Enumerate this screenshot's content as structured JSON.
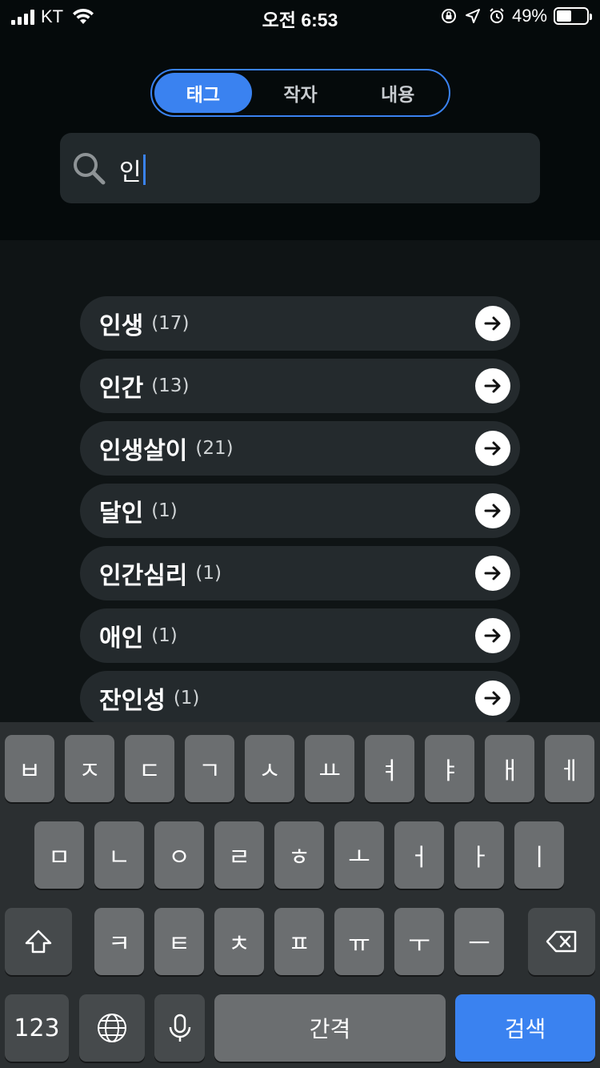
{
  "status_bar": {
    "carrier": "KT",
    "time": "오전 6:53",
    "battery": "49%",
    "battery_level": 0.49
  },
  "tabs": [
    {
      "label": "태그",
      "active": true
    },
    {
      "label": "작자",
      "active": false
    },
    {
      "label": "내용",
      "active": false
    }
  ],
  "search": {
    "value": "인",
    "icon": "search-icon"
  },
  "results": [
    {
      "name": "인생",
      "count": "(17)"
    },
    {
      "name": "인간",
      "count": "(13)"
    },
    {
      "name": "인생살이",
      "count": "(21)"
    },
    {
      "name": "달인",
      "count": "(1)"
    },
    {
      "name": "인간심리",
      "count": "(1)"
    },
    {
      "name": "애인",
      "count": "(1)"
    },
    {
      "name": "잔인성",
      "count": "(1)"
    }
  ],
  "keyboard": {
    "row1": [
      "ㅂ",
      "ㅈ",
      "ㄷ",
      "ㄱ",
      "ㅅ",
      "ㅛ",
      "ㅕ",
      "ㅑ",
      "ㅐ",
      "ㅔ"
    ],
    "row2": [
      "ㅁ",
      "ㄴ",
      "ㅇ",
      "ㄹ",
      "ㅎ",
      "ㅗ",
      "ㅓ",
      "ㅏ",
      "ㅣ"
    ],
    "row3": [
      "ㅋ",
      "ㅌ",
      "ㅊ",
      "ㅍ",
      "ㅠ",
      "ㅜ",
      "ㅡ"
    ],
    "numbers_label": "123",
    "space_label": "간격",
    "search_label": "검색"
  },
  "colors": {
    "accent": "#3a82f0",
    "background": "#0f1415",
    "row_background": "#242a2d"
  }
}
